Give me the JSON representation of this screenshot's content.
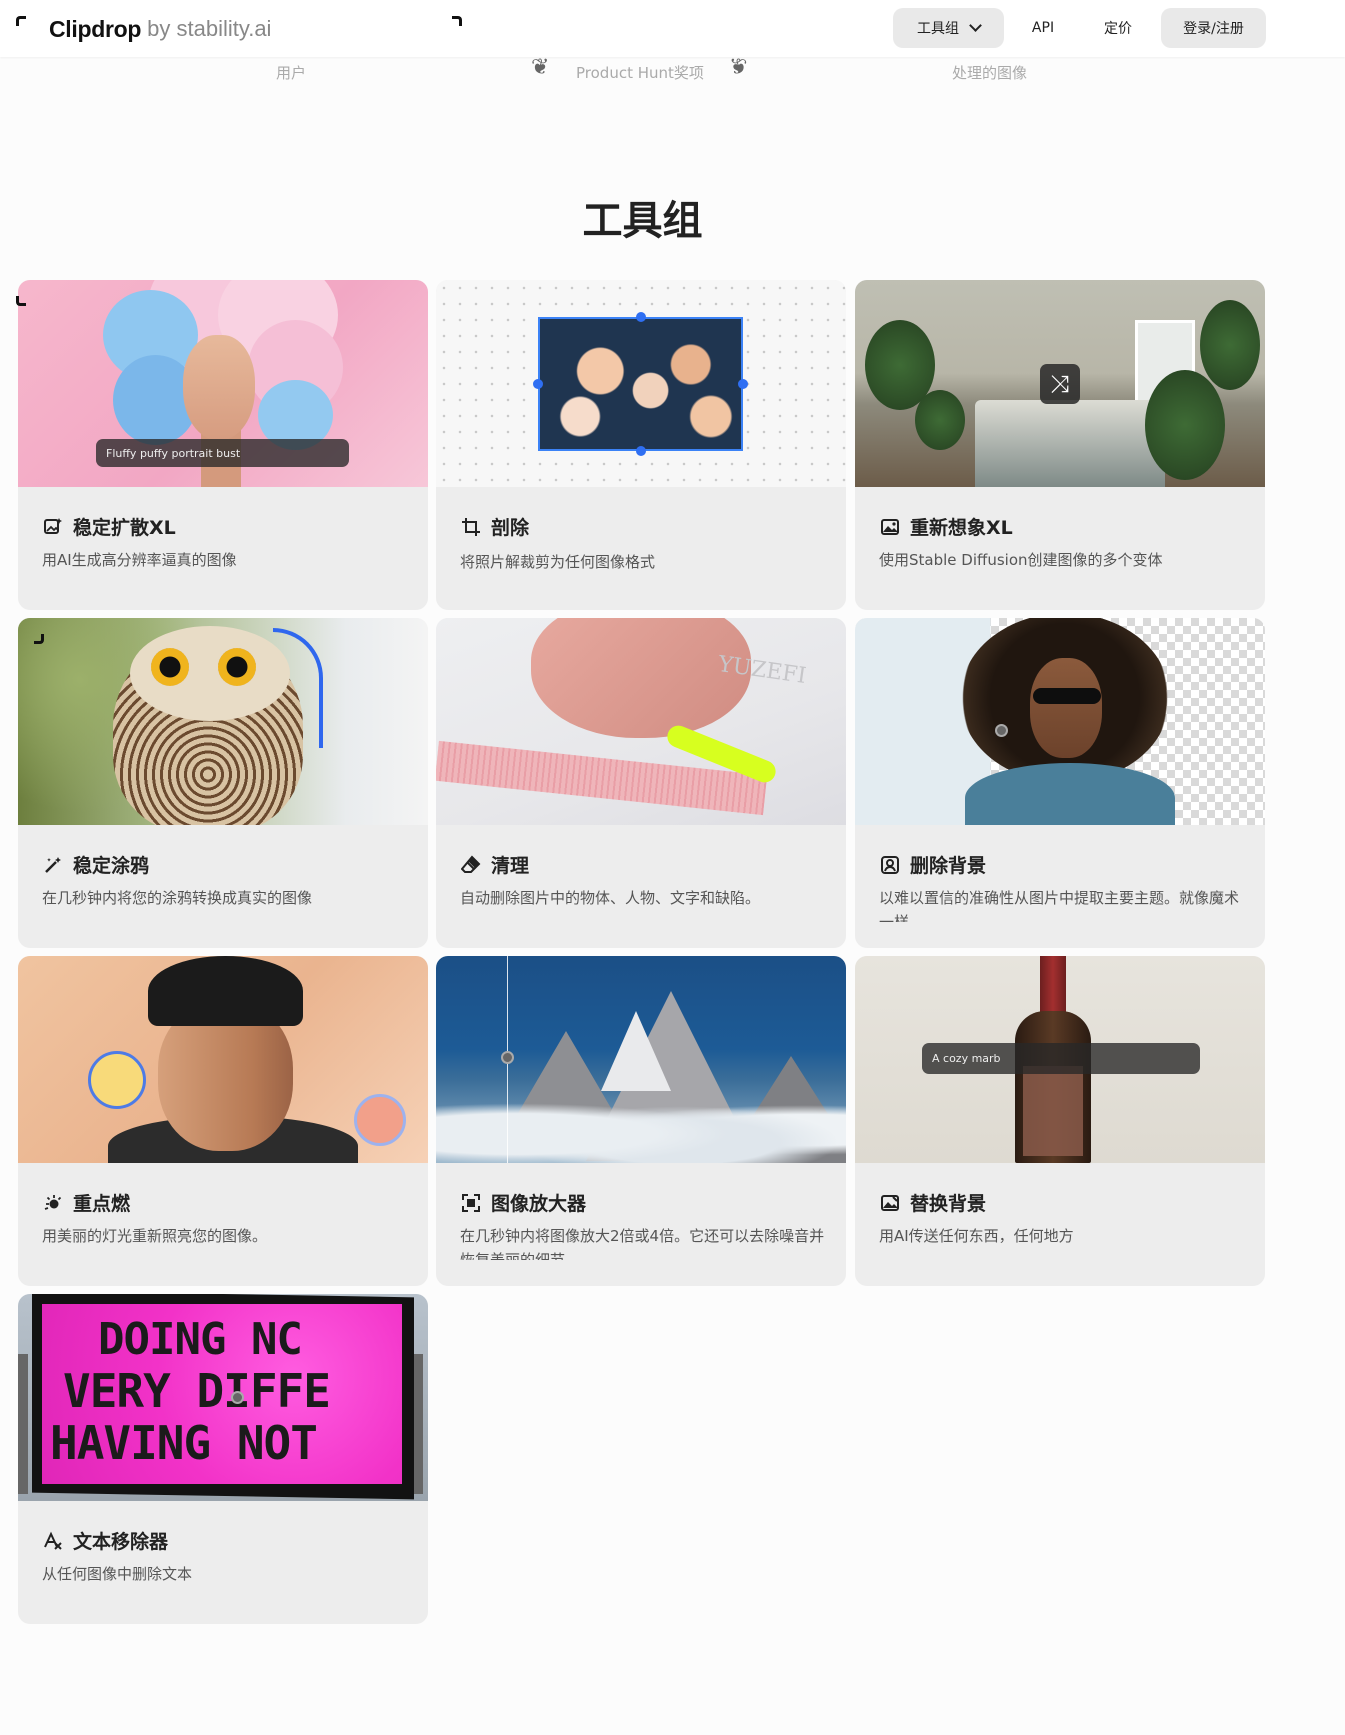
{
  "header": {
    "logo_name": "Clipdrop",
    "logo_by": "by stability.ai",
    "nav": {
      "tools_label": "工具组",
      "api_label": "API",
      "pricing_label": "定价",
      "login_label": "登录/注册"
    }
  },
  "stats": {
    "users_label": "用户",
    "hunt_label": "Product Hunt奖项",
    "images_label": "处理的图像"
  },
  "section_title": "工具组",
  "cards": [
    {
      "title": "稳定扩散XL",
      "desc": "用AI生成高分辨率逼真的图像",
      "icon": "image-sparkle-icon",
      "prompt": "Fluffy puffy portrait bust"
    },
    {
      "title": "剖除",
      "desc": "将照片解裁剪为任何图像格式",
      "icon": "crop-icon"
    },
    {
      "title": "重新想象XL",
      "desc": "使用Stable Diffusion创建图像的多个变体",
      "icon": "image-variant-icon"
    },
    {
      "title": "稳定涂鸦",
      "desc": "在几秒钟内将您的涂鸦转换成真实的图像",
      "icon": "magic-wand-icon"
    },
    {
      "title": "清理",
      "desc": "自动删除图片中的物体、人物、文字和缺陷。",
      "icon": "eraser-icon"
    },
    {
      "title": "删除背景",
      "desc": "以难以置信的准确性从图片中提取主要主题。就像魔术一样",
      "icon": "remove-background-icon"
    },
    {
      "title": "重点燃",
      "desc": "用美丽的灯光重新照亮您的图像。",
      "icon": "relight-icon"
    },
    {
      "title": "图像放大器",
      "desc": "在几秒钟内将图像放大2倍或4倍。它还可以去除噪音并恢复美丽的细节",
      "icon": "upscale-icon"
    },
    {
      "title": "替换背景",
      "desc": "用AI传送任何东西，任何地方",
      "icon": "replace-background-icon",
      "prompt": "A cozy marb"
    },
    {
      "title": "文本移除器",
      "desc": "从任何图像中删除文本",
      "icon": "text-remove-icon",
      "billboard_lines": [
        "DOING NC",
        "VERY DIFFE",
        "HAVING NOT"
      ]
    }
  ],
  "colors": {
    "accent_blue": "#2f6ff2",
    "card_bg": "#ededed",
    "highlighter": "#d7ff1f",
    "billboard_pink": "#f232c8"
  }
}
